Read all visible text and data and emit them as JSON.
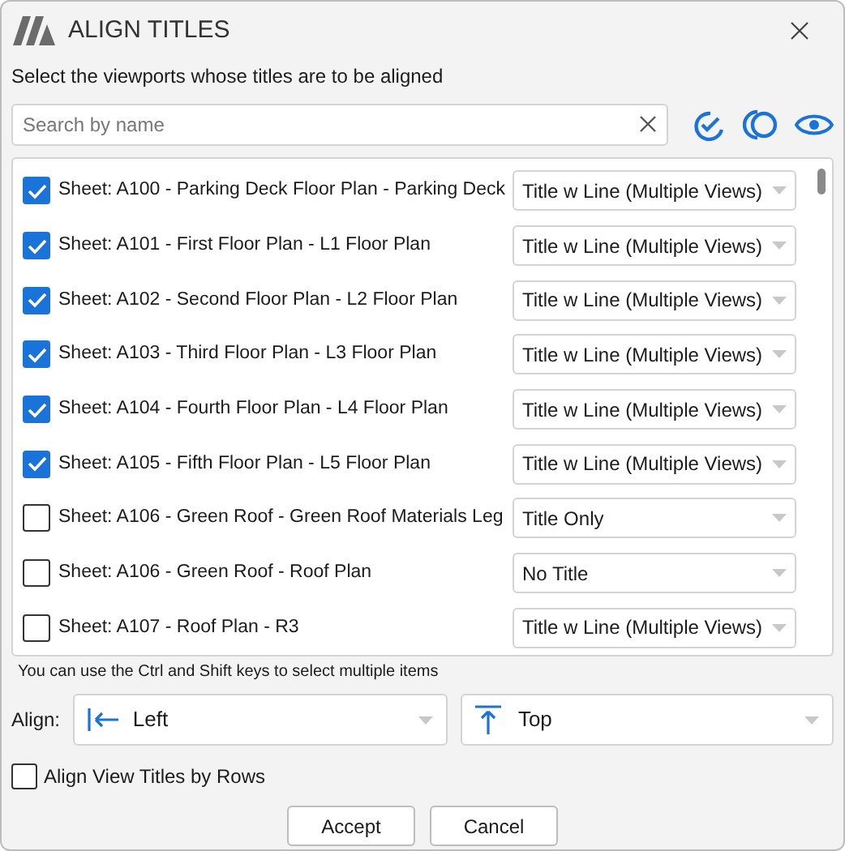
{
  "window": {
    "title": "ALIGN TITLES"
  },
  "instruction": "Select the viewports whose titles are to be aligned",
  "search": {
    "placeholder": "Search by name"
  },
  "viewports": [
    {
      "label": "Sheet: A100 - Parking Deck Floor Plan - Parking Deck",
      "checked": true,
      "title_style": "Title w Line (Multiple Views)"
    },
    {
      "label": "Sheet: A101 - First Floor Plan - L1 Floor Plan",
      "checked": true,
      "title_style": "Title w Line (Multiple Views)"
    },
    {
      "label": "Sheet: A102 - Second Floor Plan - L2 Floor Plan",
      "checked": true,
      "title_style": "Title w Line (Multiple Views)"
    },
    {
      "label": "Sheet: A103 - Third Floor Plan - L3 Floor Plan",
      "checked": true,
      "title_style": "Title w Line (Multiple Views)"
    },
    {
      "label": "Sheet: A104 - Fourth Floor Plan - L4 Floor Plan",
      "checked": true,
      "title_style": "Title w Line (Multiple Views)"
    },
    {
      "label": "Sheet: A105 - Fifth Floor Plan - L5 Floor Plan",
      "checked": true,
      "title_style": "Title w Line (Multiple Views)"
    },
    {
      "label": "Sheet: A106 - Green Roof - Green Roof Materials Leg",
      "checked": false,
      "title_style": "Title Only"
    },
    {
      "label": "Sheet: A106 - Green Roof - Roof Plan",
      "checked": false,
      "title_style": "No Title"
    },
    {
      "label": "Sheet: A107 - Roof Plan - R3",
      "checked": false,
      "title_style": "Title w Line (Multiple Views)"
    }
  ],
  "hint": "You can use the Ctrl and Shift keys to select multiple items",
  "align": {
    "label": "Align:",
    "horizontal": "Left",
    "vertical": "Top"
  },
  "align_by_rows": {
    "label": "Align View Titles by Rows",
    "checked": false
  },
  "buttons": [
    "Accept",
    "Cancel"
  ]
}
